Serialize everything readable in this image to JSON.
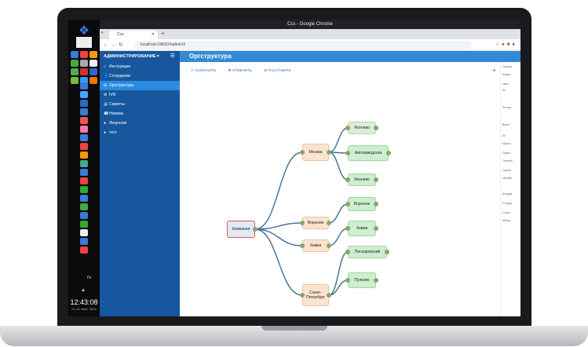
{
  "os": {
    "clock": "12:43:08",
    "date": "пт, 14 нояб. 2024",
    "lang": "ru",
    "arrow": "▲"
  },
  "browser": {
    "window_title": "Ccs - Google Chrome",
    "tab_title": "Ccs",
    "url": "localhost:19601/#admin/3",
    "new_tab": "+"
  },
  "sidebar": {
    "header": "АДМИНИСТРИРОВАНИЕ ▾",
    "items": [
      {
        "label": "Инструкции",
        "icon": "home-icon"
      },
      {
        "label": "Сотрудники",
        "icon": "user-icon"
      },
      {
        "label": "Оргструктура",
        "icon": "sitemap-icon",
        "active": true
      },
      {
        "label": "IVR",
        "icon": "ivr-icon"
      },
      {
        "label": "Скрипты",
        "icon": "script-icon"
      },
      {
        "label": "Номера",
        "icon": "phone-icon"
      },
      {
        "label": "Лицензии",
        "icon": "license-icon"
      },
      {
        "label": "тест",
        "icon": "circle-icon"
      }
    ]
  },
  "main": {
    "title": "Оргструктура",
    "toolbar": {
      "save": "✔ СОХРАНИТЬ",
      "cancel": "✖ ОТМЕНИТЬ",
      "arrange": "⊕ РАССТАВИТЬ",
      "add": "+"
    }
  },
  "tree": {
    "root": "Компания",
    "level1": [
      "Москва",
      "Воронеж",
      "Химки",
      "Санкт-Петербург"
    ],
    "leaves": [
      "Ясенево",
      "Автозаводская",
      "Ясенево",
      "Воронеж",
      "Химки",
      "Пискаревский",
      "Пулково"
    ]
  },
  "right_panel": {
    "lines": [
      "Органи",
      "Компа",
      "Цвет",
      "Ко",
      "Фотогр",
      "Вклю",
      "Ит",
      "Музык",
      "Скрип",
      "Телефо",
      "Скрипт",
      "Необбо",
      "Штруди",
      "Сотруд",
      "Сотру",
      "Женщ"
    ]
  },
  "colors": {
    "sidebar": "#16579d",
    "sidebar_active": "#2b8be0",
    "header": "#3389d6",
    "edge": "#3f6f94"
  }
}
